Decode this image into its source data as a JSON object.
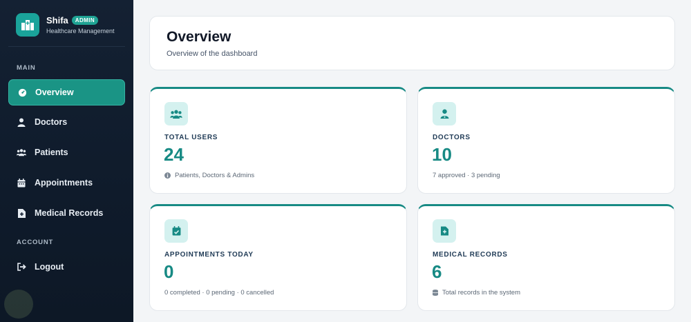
{
  "brand": {
    "name": "Shifa",
    "badge": "ADMIN",
    "subtitle": "Healthcare Management"
  },
  "sidebar": {
    "main_section": "MAIN",
    "account_section": "ACCOUNT",
    "items": [
      {
        "label": "Overview",
        "icon": "gauge-icon",
        "active": true
      },
      {
        "label": "Doctors",
        "icon": "user-doctor-icon"
      },
      {
        "label": "Patients",
        "icon": "users-icon"
      },
      {
        "label": "Appointments",
        "icon": "calendar-icon"
      },
      {
        "label": "Medical Records",
        "icon": "file-medical-icon"
      }
    ],
    "logout": {
      "label": "Logout",
      "icon": "logout-icon"
    }
  },
  "header": {
    "title": "Overview",
    "subtitle": "Overview of the dashboard"
  },
  "stats": [
    {
      "label": "TOTAL USERS",
      "value": "24",
      "note": "Patients, Doctors & Admins",
      "icon": "users-icon",
      "note_icon": "info-icon"
    },
    {
      "label": "DOCTORS",
      "value": "10",
      "note": "7 approved · 3 pending",
      "icon": "user-doctor-icon"
    },
    {
      "label": "APPOINTMENTS TODAY",
      "value": "0",
      "note": "0 completed · 0 pending · 0 cancelled",
      "icon": "calendar-check-icon"
    },
    {
      "label": "MEDICAL RECORDS",
      "value": "6",
      "note": "Total records in the system",
      "icon": "file-medical-icon",
      "note_icon": "database-icon"
    }
  ],
  "colors": {
    "accent": "#178a84",
    "sidebar_bg": "#142133",
    "active_nav": "#1a9485"
  }
}
